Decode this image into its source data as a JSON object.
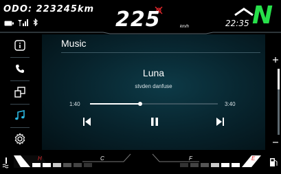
{
  "header": {
    "odo_label": "ODO:",
    "odo_value": "223245km",
    "speed": "225",
    "speed_unit": "km/h",
    "clock": "22:35",
    "gear": "N"
  },
  "sidebar": {
    "items": [
      {
        "icon": "info-icon"
      },
      {
        "icon": "phone-icon"
      },
      {
        "icon": "screen-mirror-icon"
      },
      {
        "icon": "music-note-icon",
        "active": true
      },
      {
        "icon": "gear-icon"
      }
    ]
  },
  "music": {
    "title": "Music",
    "track": "Luna",
    "artist": "stvden danfuse",
    "elapsed": "1:40",
    "total": "3:40",
    "progress": 0.39
  },
  "gauges": {
    "temp_high": "H",
    "temp_low": "C",
    "fuel_full": "F",
    "fuel_empty": "E"
  },
  "colors": {
    "accent": "#2ab6e0",
    "gear": "#27e04a",
    "warning": "#e0262b"
  }
}
